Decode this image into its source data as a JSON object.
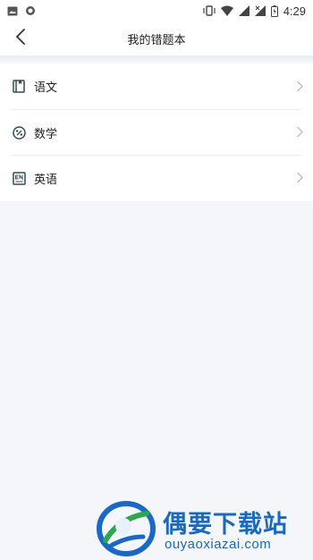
{
  "status_bar": {
    "time": "4:29",
    "icons": [
      "image-icon",
      "circle-icon",
      "vibrate-icon",
      "wifi-icon",
      "signal-icon",
      "signal-off-icon",
      "battery-icon"
    ]
  },
  "nav": {
    "title": "我的错题本",
    "back_icon": "chevron-left-icon"
  },
  "subjects": [
    {
      "label": "语文",
      "icon": "book-icon"
    },
    {
      "label": "数学",
      "icon": "percent-icon"
    },
    {
      "label": "英语",
      "icon": "en-icon"
    }
  ],
  "watermark": {
    "brand": "偶要下载站",
    "url": "ouyaoxiazai.com"
  },
  "colors": {
    "accent_icon": "#2f4f4f",
    "watermark": "#1669c9",
    "background": "#f4f6f9"
  }
}
